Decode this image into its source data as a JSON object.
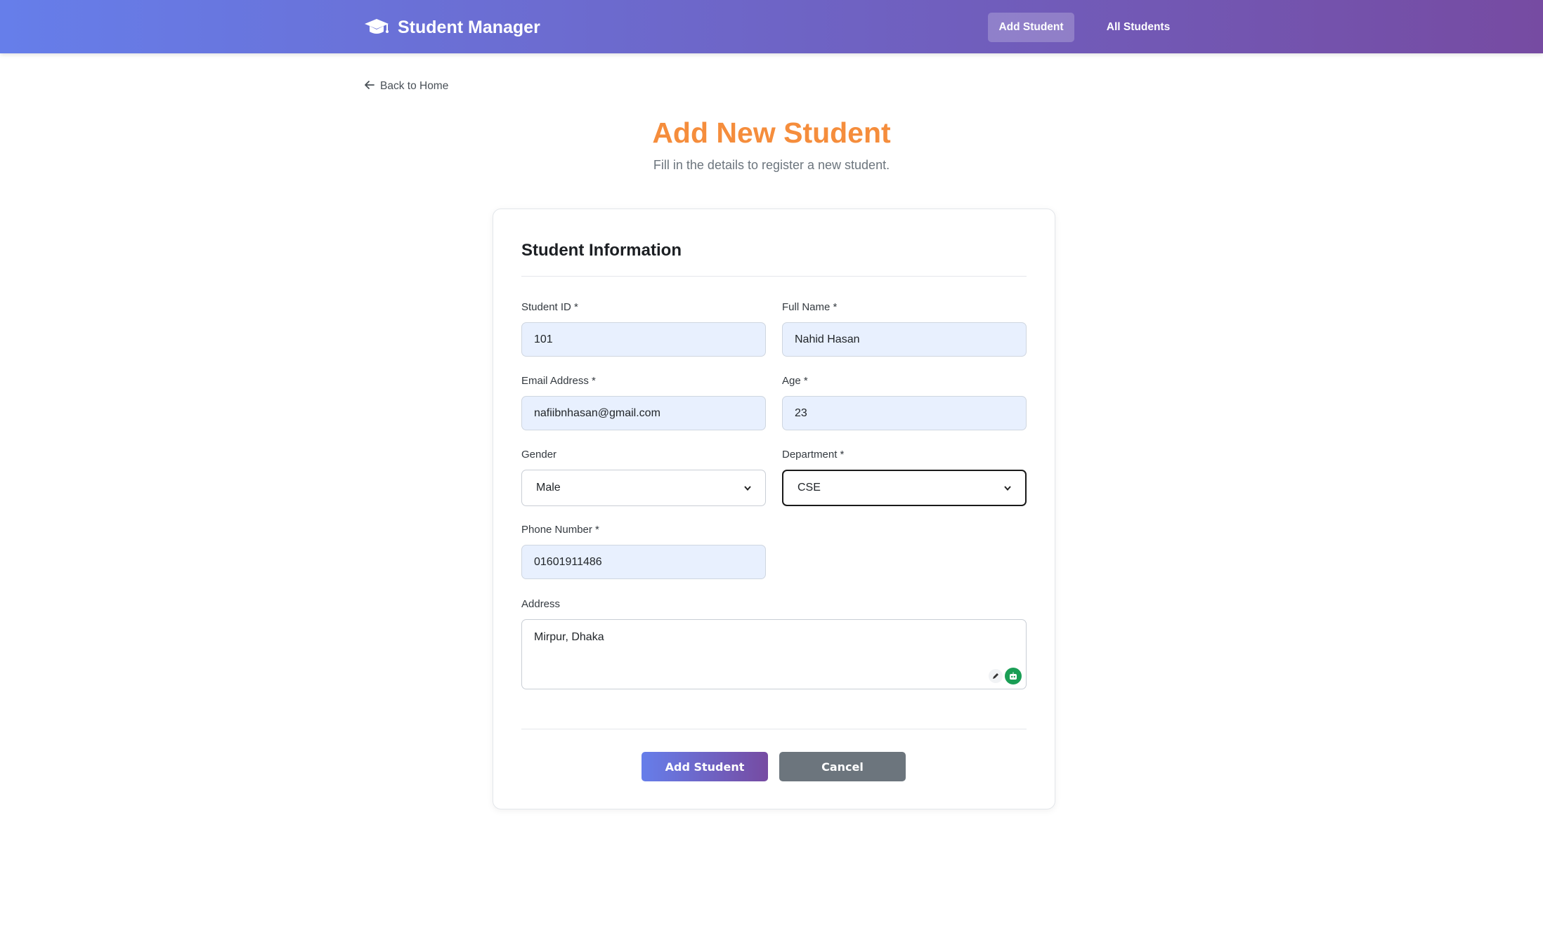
{
  "navbar": {
    "brand": "Student Manager",
    "brand_icon": "graduation-cap-icon",
    "links": [
      {
        "label": "Add Student",
        "active": true
      },
      {
        "label": "All Students",
        "active": false
      }
    ],
    "gradient": [
      "#667eea",
      "#764ba2"
    ]
  },
  "back_link": {
    "label": "Back to Home",
    "icon": "arrow-left-icon"
  },
  "page": {
    "title": "Add New Student",
    "subtitle": "Fill in the details to register a new student.",
    "title_color": "#f58d3c"
  },
  "form": {
    "section_title": "Student Information",
    "student_id": {
      "label": "Student ID *",
      "value": "101"
    },
    "full_name": {
      "label": "Full Name *",
      "value": "Nahid Hasan"
    },
    "email": {
      "label": "Email Address *",
      "value": "nafiibnhasan@gmail.com"
    },
    "age": {
      "label": "Age *",
      "value": "23"
    },
    "gender": {
      "label": "Gender",
      "value": "Male"
    },
    "department": {
      "label": "Department *",
      "value": "CSE"
    },
    "phone": {
      "label": "Phone Number *",
      "value": "01601911486"
    },
    "address": {
      "label": "Address",
      "value": "Mirpur, Dhaka"
    }
  },
  "actions": {
    "submit": "Add Student",
    "cancel": "Cancel",
    "secondary_color": "#6c757d"
  }
}
